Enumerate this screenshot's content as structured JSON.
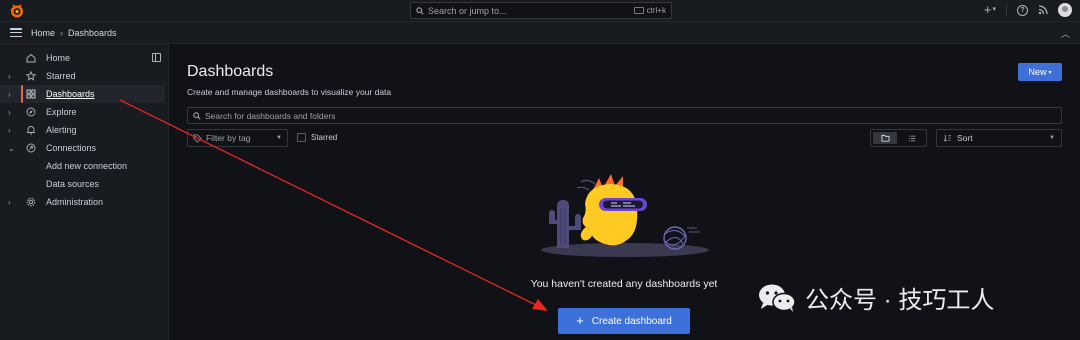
{
  "topbar": {
    "logo_icon": "grafana-logo",
    "search_placeholder": "Search or jump to...",
    "search_shortcut": "ctrl+k",
    "add_icon": "plus-icon",
    "help_icon": "help-icon",
    "news_icon": "rss-icon"
  },
  "breadcrumb": {
    "home": "Home",
    "separator": "›",
    "current": "Dashboards"
  },
  "sidebar": {
    "items": [
      {
        "label": "Home",
        "icon": "home-icon"
      },
      {
        "label": "Starred",
        "icon": "star-icon"
      },
      {
        "label": "Dashboards",
        "icon": "apps-icon"
      },
      {
        "label": "Explore",
        "icon": "compass-icon"
      },
      {
        "label": "Alerting",
        "icon": "bell-icon"
      },
      {
        "label": "Connections",
        "icon": "link-icon"
      },
      {
        "label": "Add new connection"
      },
      {
        "label": "Data sources"
      },
      {
        "label": "Administration",
        "icon": "gear-icon"
      }
    ],
    "accent": "#f55f3e"
  },
  "main": {
    "title": "Dashboards",
    "subtitle": "Create and manage dashboards to visualize your data",
    "new_label": "New",
    "search_placeholder": "Search for dashboards and folders",
    "filter_tag_label": "Filter by tag",
    "starred_label": "Starred",
    "sort_label": "Sort",
    "empty_message": "You haven't created any dashboards yet",
    "create_label": "Create dashboard",
    "primary_color": "#3d71d9"
  },
  "watermark": {
    "text": "公众号 · 技巧工人"
  },
  "annotation": {
    "arrow_color": "#e8271f"
  }
}
